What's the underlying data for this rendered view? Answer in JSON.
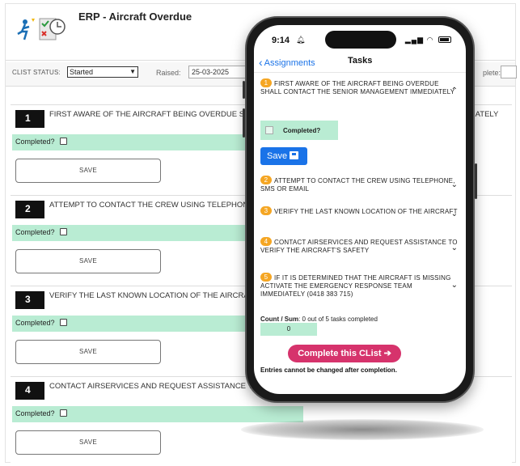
{
  "desktop": {
    "title": "ERP - Aircraft Overdue",
    "clist_status_label": "CLIST STATUS:",
    "clist_status_value": "Started",
    "raised_label": "Raised:",
    "raised_value": "25-03-2025",
    "complete_label": "plete:",
    "tasks": [
      {
        "number": "1",
        "text": "FIRST AWARE OF THE AIRCRAFT BEING OVERDUE SHALL CONTACT THE SENIOR MANAGEMENT IMMEDIATELY",
        "tail": "IATELY",
        "completed_label": "Completed?",
        "save_label": "SAVE"
      },
      {
        "number": "2",
        "text": "ATTEMPT TO CONTACT THE CREW USING TELEPHONE, SMS OR EMAIL",
        "tail": "",
        "completed_label": "Completed?",
        "save_label": "SAVE"
      },
      {
        "number": "3",
        "text": "VERIFY THE LAST KNOWN LOCATION OF THE AIRCRAFT",
        "tail": "",
        "completed_label": "Completed?",
        "save_label": "SAVE"
      },
      {
        "number": "4",
        "text": "CONTACT AIRSERVICES AND REQUEST ASSISTANCE TO VERIFY THE AIRCRAFT'S SAFETY",
        "tail": "",
        "completed_label": "Completed?",
        "save_label": "SAVE"
      }
    ]
  },
  "phone": {
    "time": "9:14",
    "back_label": "Assignments",
    "nav_title": "Tasks",
    "items": [
      {
        "number": "1",
        "text": "FIRST AWARE OF THE AIRCRAFT BEING OVERDUE SHALL CONTACT THE SENIOR MANAGEMENT IMMEDIATELY",
        "expanded": true
      },
      {
        "number": "2",
        "text": "ATTEMPT TO CONTACT THE CREW USING TELEPHONE, SMS OR EMAIL",
        "expanded": false
      },
      {
        "number": "3",
        "text": "VERIFY THE LAST KNOWN LOCATION OF THE AIRCRAFT",
        "expanded": false
      },
      {
        "number": "4",
        "text": "CONTACT AIRSERVICES AND REQUEST ASSISTANCE TO VERIFY THE AIRCRAFT'S SAFETY",
        "expanded": false
      },
      {
        "number": "5",
        "text": "IF IT IS DETERMINED THAT THE AIRCRAFT IS MISSING ACTIVATE THE EMERGENCY RESPONSE TEAM IMMEDIATELY (0418 383 715)",
        "expanded": false
      }
    ],
    "completed_label": "Completed?",
    "save_label": "Save",
    "count_label": "Count / Sum",
    "count_text": ": 0 out of 5 tasks completed",
    "count_value": "0",
    "complete_button": "Complete this CList",
    "complete_arrow": "➔",
    "note": "Entries cannot be changed after completion."
  },
  "colors": {
    "accent_blue": "#1a73e8",
    "completed_green": "#b9ecd3",
    "badge_orange": "#f5a623",
    "complete_pink": "#d6336c"
  }
}
